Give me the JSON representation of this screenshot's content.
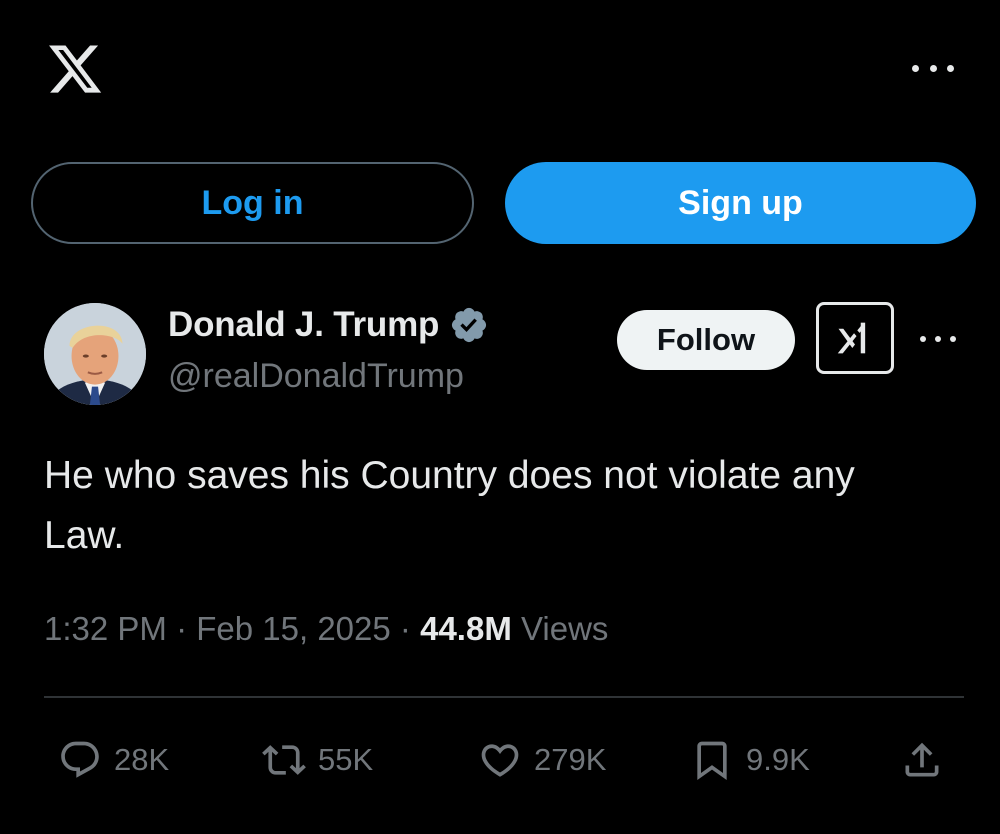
{
  "header": {
    "logo_icon": "x-logo-icon",
    "more_icon": "more-horizontal-icon"
  },
  "auth": {
    "login_label": "Log in",
    "signup_label": "Sign up",
    "accent_color": "#1d9bf0"
  },
  "post": {
    "author": {
      "display_name": "Donald J. Trump",
      "handle": "@realDonaldTrump",
      "verified": true,
      "verified_color": "#829aab"
    },
    "follow_label": "Follow",
    "grok_icon": "grok-icon",
    "text": "He who saves his Country does not violate any Law.",
    "time": "1:32 PM",
    "date": "Feb 15, 2025",
    "separator": "·",
    "views_count": "44.8M",
    "views_label": "Views",
    "stats": {
      "replies": "28K",
      "reposts": "55K",
      "likes": "279K",
      "bookmarks": "9.9K"
    }
  }
}
